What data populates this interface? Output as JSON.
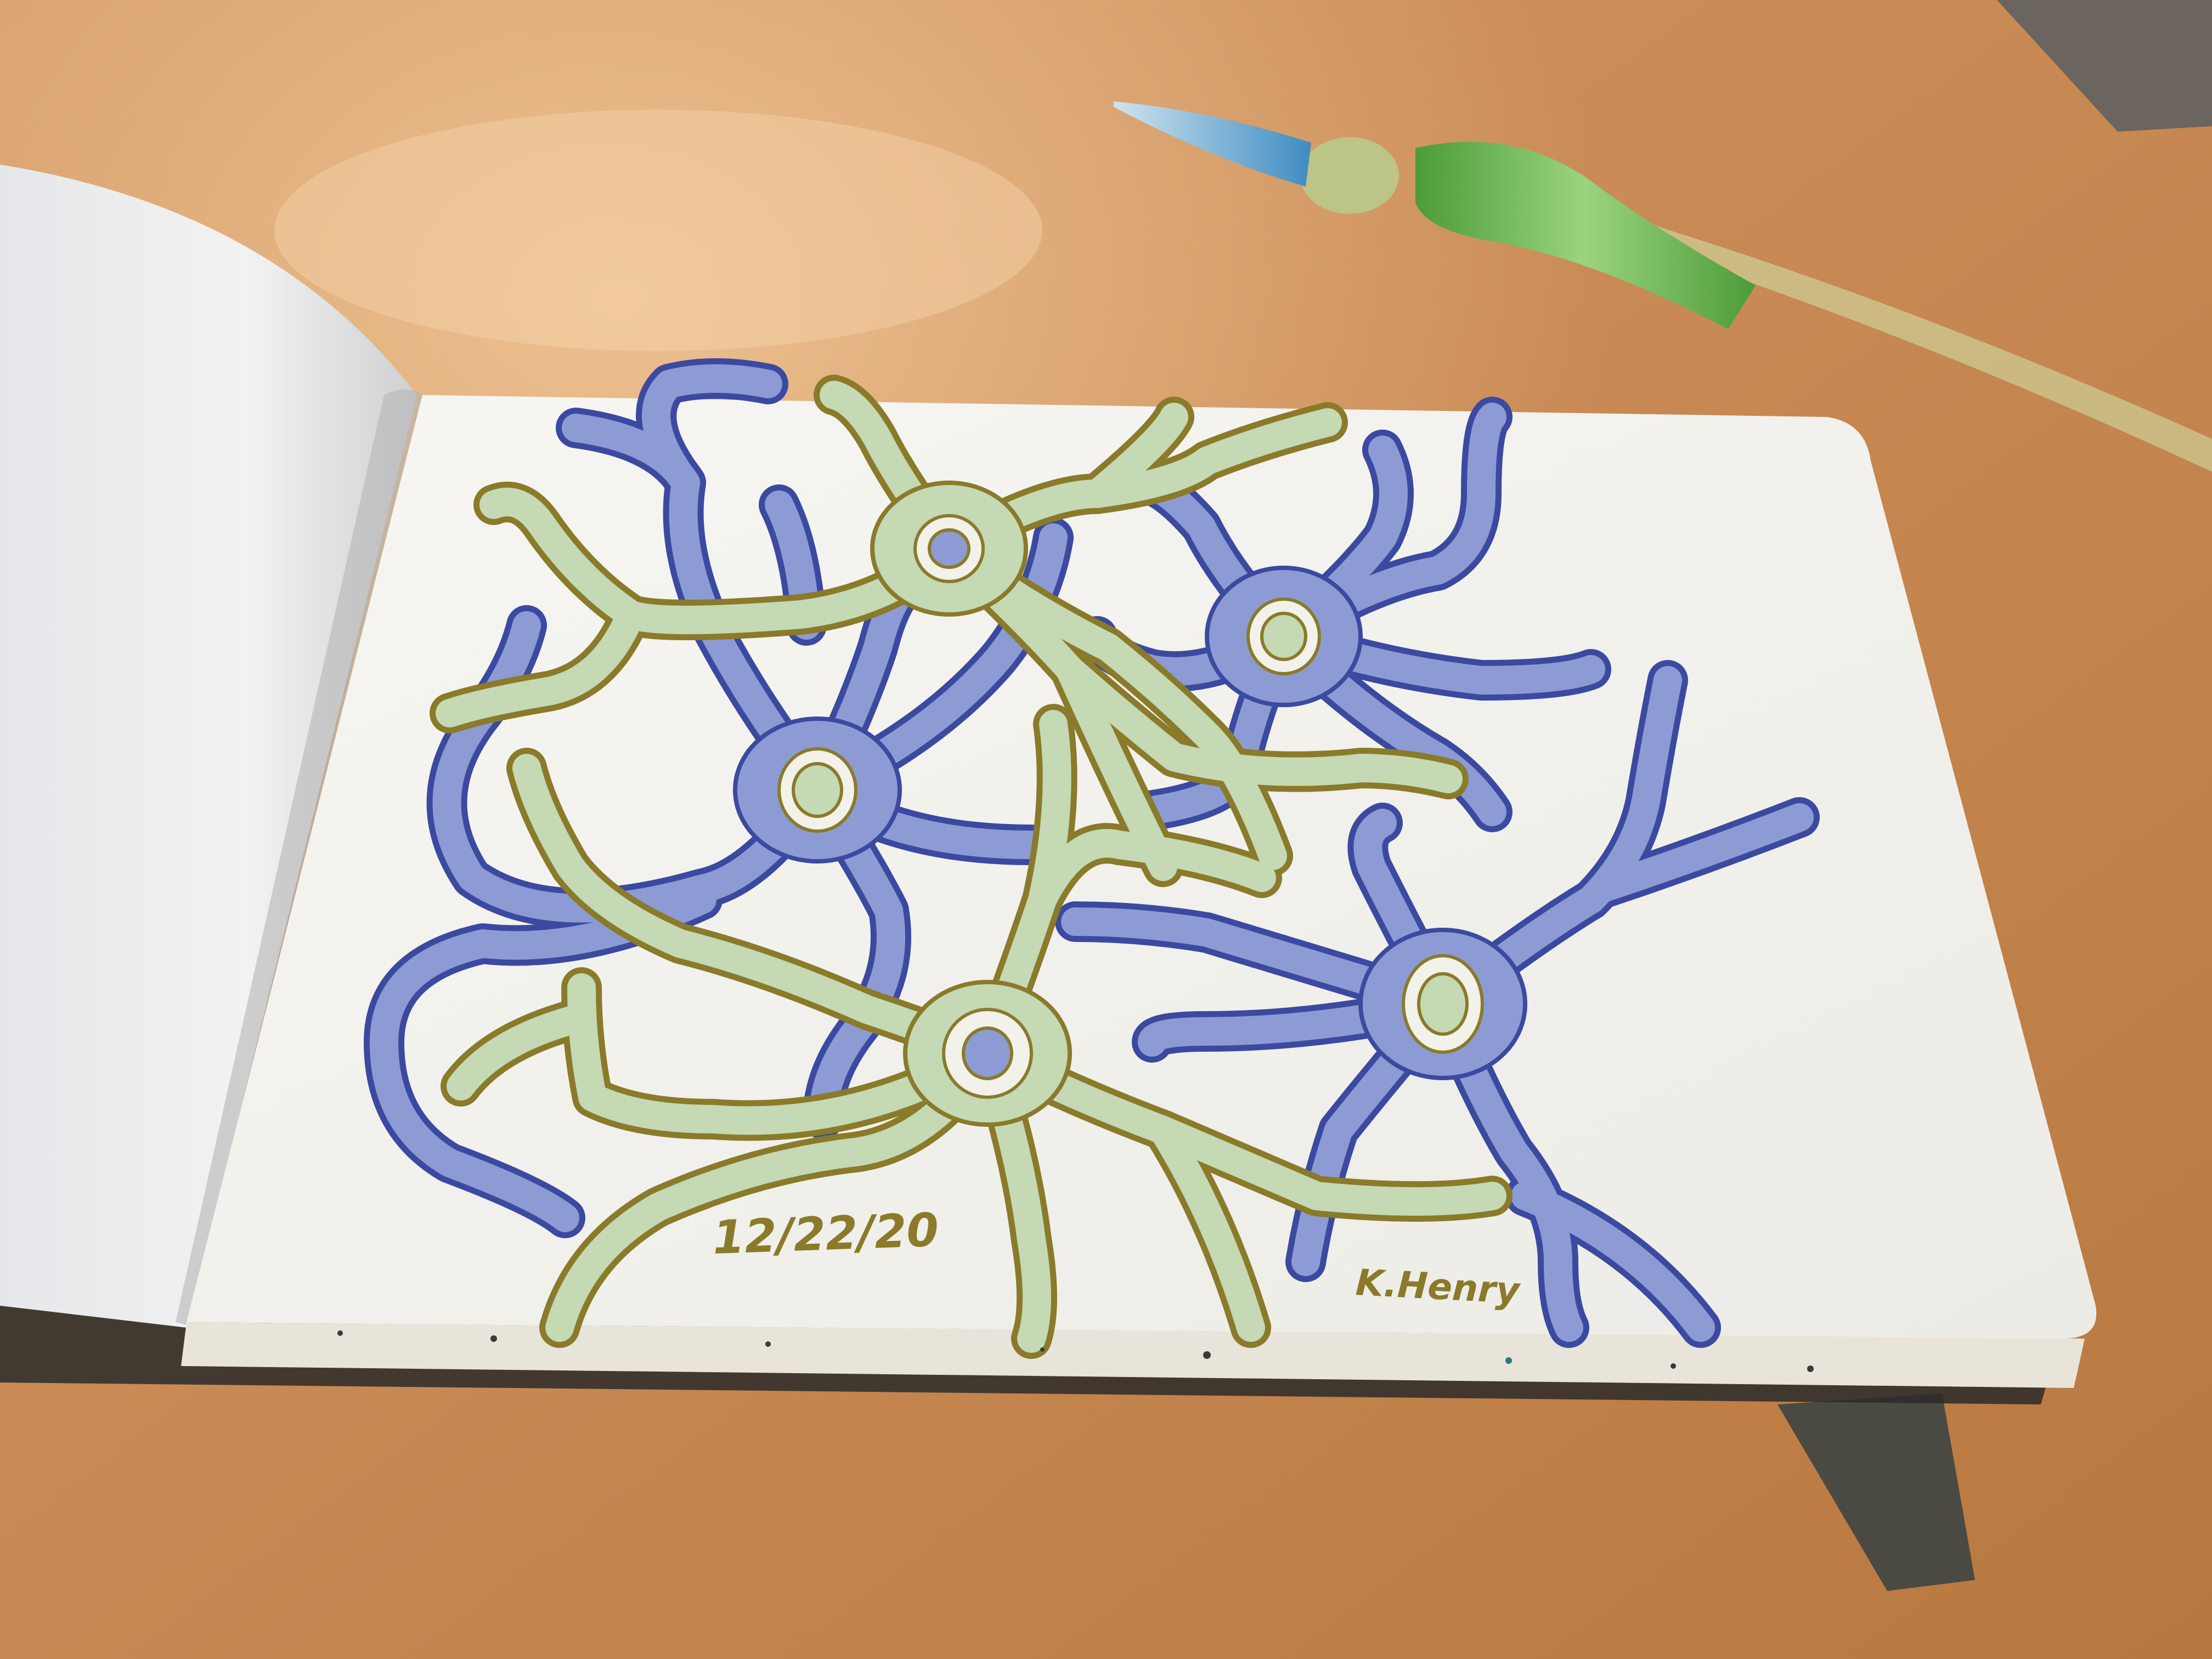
{
  "sketch": {
    "date": "12/22/20",
    "signature": "K.Henry"
  },
  "colors": {
    "table": "#c98a55",
    "table_light": "#e0ab7a",
    "table_dark": "#a8693a",
    "paper": "#f4f3ee",
    "paper_shadow": "#dcdcd8",
    "blue_cell_fill": "#8d9bd4",
    "blue_cell_outline": "#3b4aa0",
    "green_cell_fill": "#c4d9b4",
    "green_cell_outline": "#8a7a2a",
    "pen_green": "#6fbf5a",
    "pen_blue": "#5aa9d6",
    "bookmark": "#4a4a42"
  }
}
